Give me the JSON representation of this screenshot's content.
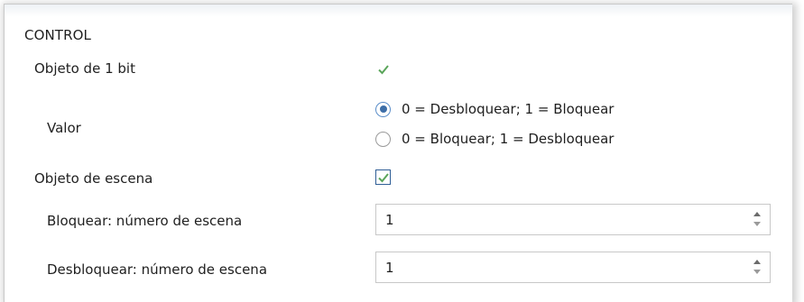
{
  "panel": {
    "section_title": "CONTROL",
    "object_1bit": {
      "label": "Objeto de 1 bit",
      "checked": true
    },
    "value": {
      "label": "Valor",
      "options": [
        {
          "label": "0 = Desbloquear; 1 = Bloquear",
          "selected": true
        },
        {
          "label": "0 = Bloquear; 1 = Desbloquear",
          "selected": false
        }
      ]
    },
    "scene_object": {
      "label": "Objeto de escena",
      "checked": true
    },
    "lock_scene": {
      "label": "Bloquear: número de escena",
      "value": "1"
    },
    "unlock_scene": {
      "label": "Desbloquear: número de escena",
      "value": "1"
    }
  },
  "colors": {
    "check": "#5aa55a",
    "focus_border": "#2f5e96",
    "radio_selected": "#3d6ea8"
  },
  "icons": [
    "checkmark-icon",
    "radio-selected-icon",
    "spinner-up-icon",
    "spinner-down-icon"
  ]
}
